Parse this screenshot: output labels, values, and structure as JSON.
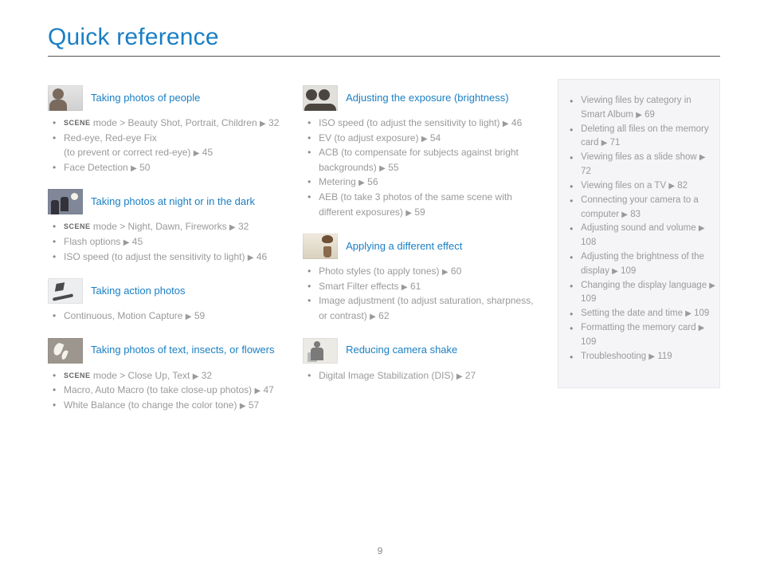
{
  "title": "Quick reference",
  "pageNumber": "9",
  "arrow": "▶",
  "scene": "SCENE",
  "col1": {
    "sections": [
      {
        "heading": "Taking photos of people",
        "thumb": "people",
        "items": [
          {
            "sceneLead": true,
            "text": " mode > Beauty Shot, Portrait, Children",
            "page": "32"
          },
          {
            "text": "Red-eye, Red-eye Fix\n(to prevent or correct red-eye)",
            "page": "45"
          },
          {
            "text": "Face Detection",
            "page": "50"
          }
        ]
      },
      {
        "heading": "Taking photos at night or in the dark",
        "thumb": "night",
        "items": [
          {
            "sceneLead": true,
            "text": " mode > Night, Dawn, Fireworks",
            "page": "32"
          },
          {
            "text": "Flash options",
            "page": "45"
          },
          {
            "text": "ISO speed (to adjust the sensitivity to light)",
            "page": "46"
          }
        ]
      },
      {
        "heading": "Taking action photos",
        "thumb": "action",
        "items": [
          {
            "text": "Continuous, Motion Capture",
            "page": "59"
          }
        ]
      },
      {
        "heading": "Taking photos of text, insects, or flowers",
        "thumb": "flower",
        "items": [
          {
            "sceneLead": true,
            "text": " mode > Close Up, Text",
            "page": "32"
          },
          {
            "text": "Macro, Auto Macro (to take close-up photos)",
            "page": "47"
          },
          {
            "text": "White Balance (to change the color tone)",
            "page": "57"
          }
        ]
      }
    ]
  },
  "col2": {
    "sections": [
      {
        "heading": "Adjusting the exposure (brightness)",
        "thumb": "exposure",
        "items": [
          {
            "text": "ISO speed (to adjust the sensitivity to light)",
            "page": "46"
          },
          {
            "text": "EV (to adjust exposure)",
            "page": "54"
          },
          {
            "text": "ACB (to compensate for subjects against bright backgrounds)",
            "page": "55"
          },
          {
            "text": "Metering",
            "page": "56"
          },
          {
            "text": "AEB (to take 3 photos of the same scene with different exposures)",
            "page": "59"
          }
        ]
      },
      {
        "heading": "Applying a different effect",
        "thumb": "effect",
        "items": [
          {
            "text": "Photo styles (to apply tones)",
            "page": "60"
          },
          {
            "text": "Smart Filter effects",
            "page": "61"
          },
          {
            "text": "Image adjustment (to adjust saturation, sharpness, or contrast)",
            "page": "62"
          }
        ]
      },
      {
        "heading": "Reducing camera shake",
        "thumb": "shake",
        "items": [
          {
            "text": "Digital Image Stabilization (DIS)",
            "page": "27"
          }
        ]
      }
    ]
  },
  "side": [
    {
      "text": "Viewing files by category in Smart Album",
      "page": "69"
    },
    {
      "text": "Deleting all files on the memory card",
      "page": "71"
    },
    {
      "text": "Viewing files as a slide show",
      "page": "72"
    },
    {
      "text": "Viewing files on a TV",
      "page": "82"
    },
    {
      "text": "Connecting your camera to a computer",
      "page": "83"
    },
    {
      "text": "Adjusting sound and volume",
      "page": "108"
    },
    {
      "text": "Adjusting the brightness of the display",
      "page": "109"
    },
    {
      "text": "Changing the display language",
      "page": "109"
    },
    {
      "text": "Setting the date and time",
      "page": "109"
    },
    {
      "text": "Formatting the memory card",
      "page": "109"
    },
    {
      "text": "Troubleshooting",
      "page": "119"
    }
  ]
}
